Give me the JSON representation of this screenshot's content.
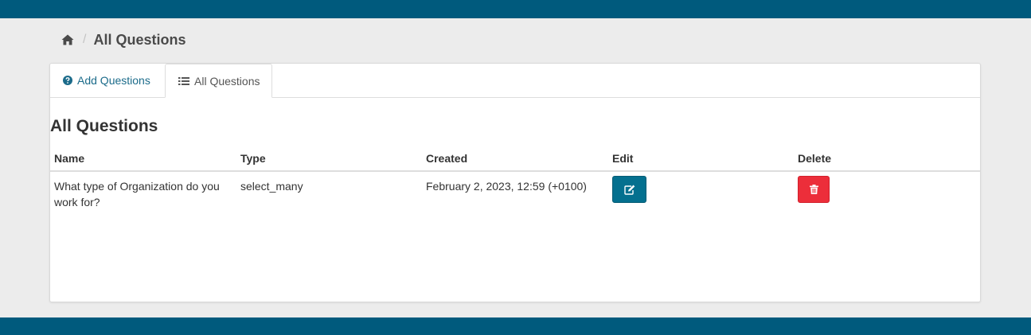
{
  "breadcrumb": {
    "home_icon": "home-icon",
    "current": "All Questions"
  },
  "tabs": [
    {
      "label": "Add Questions",
      "icon": "question-circle-icon",
      "active": false
    },
    {
      "label": "All Questions",
      "icon": "list-icon",
      "active": true
    }
  ],
  "section_title": "All Questions",
  "table": {
    "headers": [
      "Name",
      "Type",
      "Created",
      "Edit",
      "Delete"
    ],
    "rows": [
      {
        "name": "What type of Organization do you work for?",
        "type": "select_many",
        "created": "February 2, 2023, 12:59 (+0100)",
        "edit_icon": "edit-icon",
        "delete_icon": "trash-icon"
      }
    ]
  },
  "colors": {
    "brand": "#005a7d",
    "edit_button": "#04708f",
    "delete_button": "#ec2e3a",
    "link": "#1b6b8a"
  }
}
